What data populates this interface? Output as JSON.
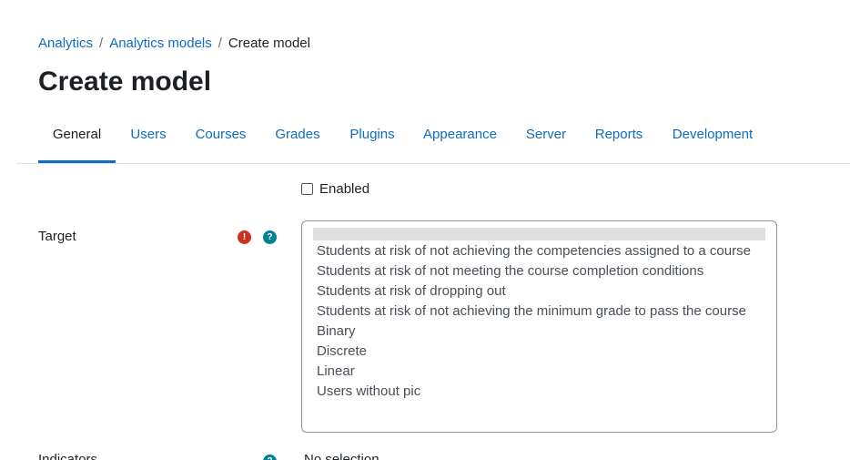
{
  "breadcrumb": {
    "items": [
      "Analytics",
      "Analytics models"
    ],
    "current": "Create model",
    "separator": "/"
  },
  "page": {
    "title": "Create model"
  },
  "tabs": [
    {
      "label": "General",
      "active": true
    },
    {
      "label": "Users"
    },
    {
      "label": "Courses"
    },
    {
      "label": "Grades"
    },
    {
      "label": "Plugins"
    },
    {
      "label": "Appearance"
    },
    {
      "label": "Server"
    },
    {
      "label": "Reports"
    },
    {
      "label": "Development"
    }
  ],
  "form": {
    "enabled_label": "Enabled",
    "enabled_checked": false,
    "target": {
      "label": "Target",
      "required_icon": "exclamation-icon",
      "help_icon": "question-icon",
      "options": [
        "Students at risk of not achieving the competencies assigned to a course",
        "Students at risk of not meeting the course completion conditions",
        "Students at risk of dropping out",
        "Students at risk of not achieving the minimum grade to pass the course",
        "Binary",
        "Discrete",
        "Linear",
        "Users without pic"
      ]
    },
    "indicators": {
      "label": "Indicators",
      "value": "No selection"
    }
  },
  "colors": {
    "link": "#0f6cbf",
    "text": "#1d2125",
    "required": "#ca3120",
    "help": "#008196",
    "border": "#dee2e6"
  }
}
